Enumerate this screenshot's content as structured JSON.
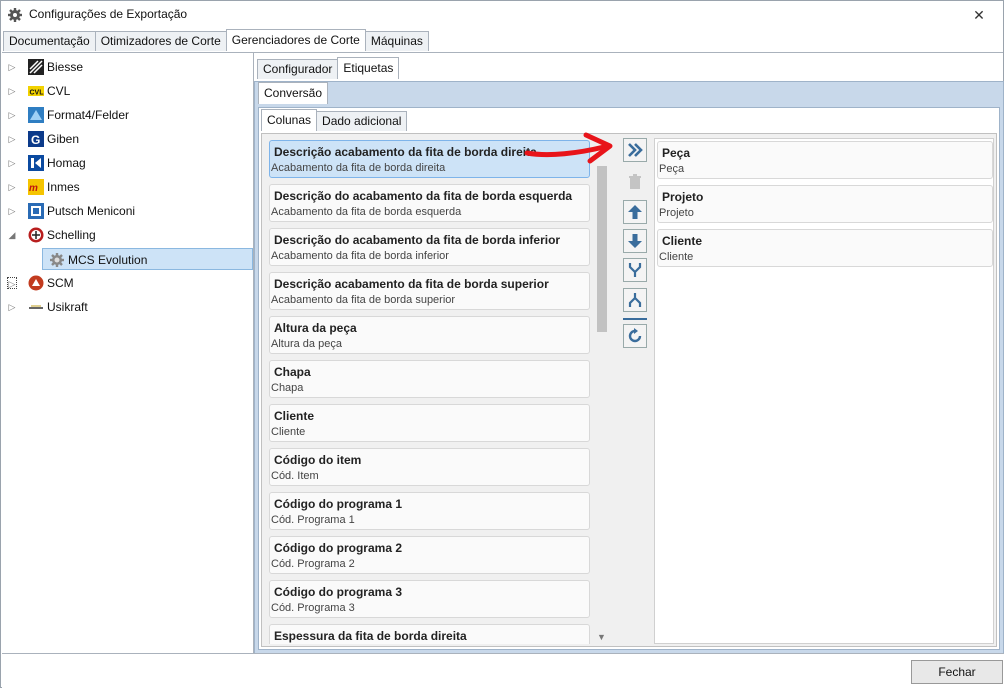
{
  "window": {
    "title": "Configurações de Exportação",
    "close_glyph": "✕"
  },
  "top_tabs": [
    "Documentação",
    "Otimizadores de Corte",
    "Gerenciadores de Corte",
    "Máquinas"
  ],
  "tree": [
    {
      "label": "Biesse",
      "icon": "biesse-logo-icon",
      "color": "#222222"
    },
    {
      "label": "CVL",
      "icon": "cvl-logo-icon",
      "color": "#d9b800"
    },
    {
      "label": "Format4/Felder",
      "icon": "format4-logo-icon",
      "color": "#2f7ec2"
    },
    {
      "label": "Giben",
      "icon": "giben-logo-icon",
      "color": "#0b3a8a"
    },
    {
      "label": "Homag",
      "icon": "homag-logo-icon",
      "color": "#0b4aa0"
    },
    {
      "label": "Inmes",
      "icon": "inmes-logo-icon",
      "color": "#c0160e"
    },
    {
      "label": "Putsch Meniconi",
      "icon": "putsch-logo-icon",
      "color": "#2a6bb5"
    },
    {
      "label": "Schelling",
      "icon": "schelling-logo-icon",
      "color": "#b81e1e"
    },
    {
      "label": "MCS Evolution",
      "icon": "gear-icon",
      "color": "#888888"
    },
    {
      "label": "SCM",
      "icon": "scm-logo-icon",
      "color": "#c23b1f"
    },
    {
      "label": "Usikraft",
      "icon": "usikraft-logo-icon",
      "color": "#666666"
    }
  ],
  "sub_tabs": [
    "Configurador",
    "Etiquetas"
  ],
  "conversion_tab": "Conversão",
  "column_tabs": [
    "Colunas",
    "Dado adicional"
  ],
  "available_columns": [
    {
      "title": "Descrição acabamento da fita de borda direita",
      "subtitle": "Acabamento da fita de borda direita"
    },
    {
      "title": "Descrição do acabamento da fita de borda esquerda",
      "subtitle": "Acabamento da fita de borda esquerda"
    },
    {
      "title": "Descrição do acabamento da fita de borda inferior",
      "subtitle": "Acabamento da fita de borda inferior"
    },
    {
      "title": "Descrição acabamento da fita de borda superior",
      "subtitle": "Acabamento da fita de borda superior"
    },
    {
      "title": "Altura da peça",
      "subtitle": "Altura da peça"
    },
    {
      "title": "Chapa",
      "subtitle": "Chapa"
    },
    {
      "title": "Cliente",
      "subtitle": "Cliente"
    },
    {
      "title": "Código do item",
      "subtitle": "Cód. Item"
    },
    {
      "title": "Código do programa 1",
      "subtitle": "Cód. Programa 1"
    },
    {
      "title": "Código do programa 2",
      "subtitle": "Cód. Programa 2"
    },
    {
      "title": "Código do programa 3",
      "subtitle": "Cód. Programa 3"
    },
    {
      "title": "Espessura da fita de borda direita",
      "subtitle": ""
    }
  ],
  "selected_columns": [
    {
      "title": "Peça",
      "subtitle": "Peça"
    },
    {
      "title": "Projeto",
      "subtitle": "Projeto"
    },
    {
      "title": "Cliente",
      "subtitle": "Cliente"
    }
  ],
  "footer": {
    "close_label": "Fechar"
  },
  "colors": {
    "accent": "#3a6d9c",
    "selection": "#cde3f7",
    "annotation": "#e8141a"
  }
}
